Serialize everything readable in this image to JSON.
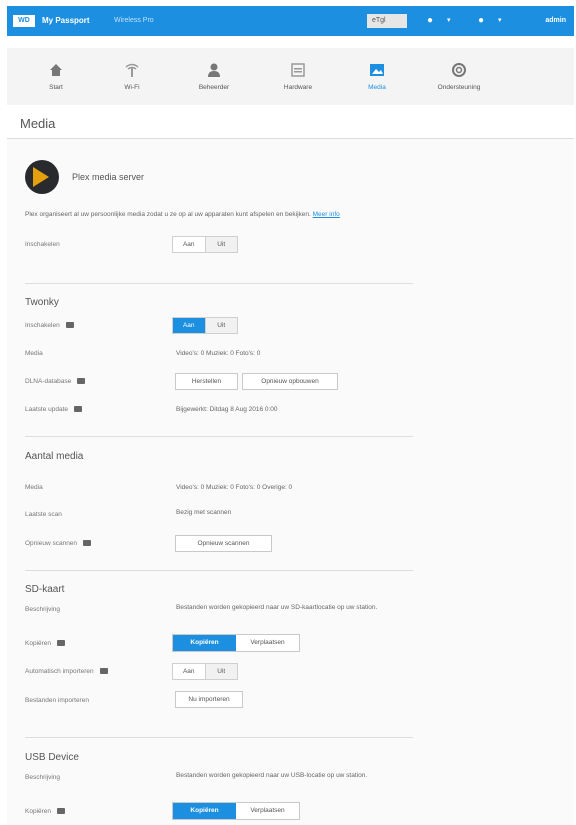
{
  "app": {
    "logo": "WD",
    "title": "My Passport",
    "subtitle": "Wireless Pro",
    "usb_label": "eTgl",
    "admin_label": "admin"
  },
  "nav": [
    {
      "label": "Start",
      "icon": "home-icon"
    },
    {
      "label": "Wi-Fi",
      "icon": "wifi-icon"
    },
    {
      "label": "Beheerder",
      "icon": "user-icon"
    },
    {
      "label": "Hardware",
      "icon": "hardware-icon"
    },
    {
      "label": "Media",
      "icon": "media-icon"
    },
    {
      "label": "Ondersteuning",
      "icon": "support-icon"
    }
  ],
  "page_title": "Media",
  "plex": {
    "title": "Plex media server",
    "description": "Plex organiseert al uw persoonlijke media zodat u ze op al uw apparaten kunt afspelen en bekijken.",
    "link": "Meer info",
    "label": "Inschakelen",
    "toggle_on": "Aan",
    "toggle_off": "Uit"
  },
  "twonky": {
    "title": "Twonky",
    "enable_label": "Inschakelen",
    "toggle_on": "Aan",
    "toggle_off": "Uit",
    "media_label": "Media",
    "media_value": "Video's: 0    Muziek: 0    Foto's: 0",
    "library_label": "DLNA-database",
    "btn_rebuild": "Herstellen",
    "btn_reset": "Opnieuw opbouwen",
    "last_update_label": "Laatste update",
    "last_update_value": "Bijgewerkt: Ditdag 8 Aug 2016 0:00"
  },
  "kaartmedia": {
    "title": "Aantal media",
    "media_label": "Media",
    "media_value": "Video's: 0    Muziek: 0    Foto's: 0    Overige: 0",
    "status_label": "Laatste scan",
    "status_value": "Bezig met scannen",
    "rescan_label": "Opnieuw scannen",
    "btn_rescan": "Opnieuw scannen"
  },
  "sd": {
    "title": "SD-kaart",
    "desc_label": "Beschrijving",
    "description": "Bestanden worden gekopieerd naar uw SD-kaartlocatie op uw station.",
    "action_label": "Kopiëren",
    "seg_copy": "Kopiëren",
    "seg_move": "Verplaatsen",
    "auto_label": "Automatisch importeren",
    "auto_on": "Aan",
    "auto_off": "Uit",
    "import_label": "Bestanden importeren",
    "btn_import": "Nu importeren"
  },
  "usb": {
    "title": "USB Device",
    "desc_label": "Beschrijving",
    "description": "Bestanden worden gekopieerd naar uw USB-locatie op uw station.",
    "action_label": "Kopiëren",
    "seg_copy": "Kopiëren",
    "seg_move": "Verplaatsen"
  },
  "colors": {
    "accent": "#1d8fe0",
    "plex_orange": "#e5a00d",
    "plex_dark": "#282a2d"
  }
}
